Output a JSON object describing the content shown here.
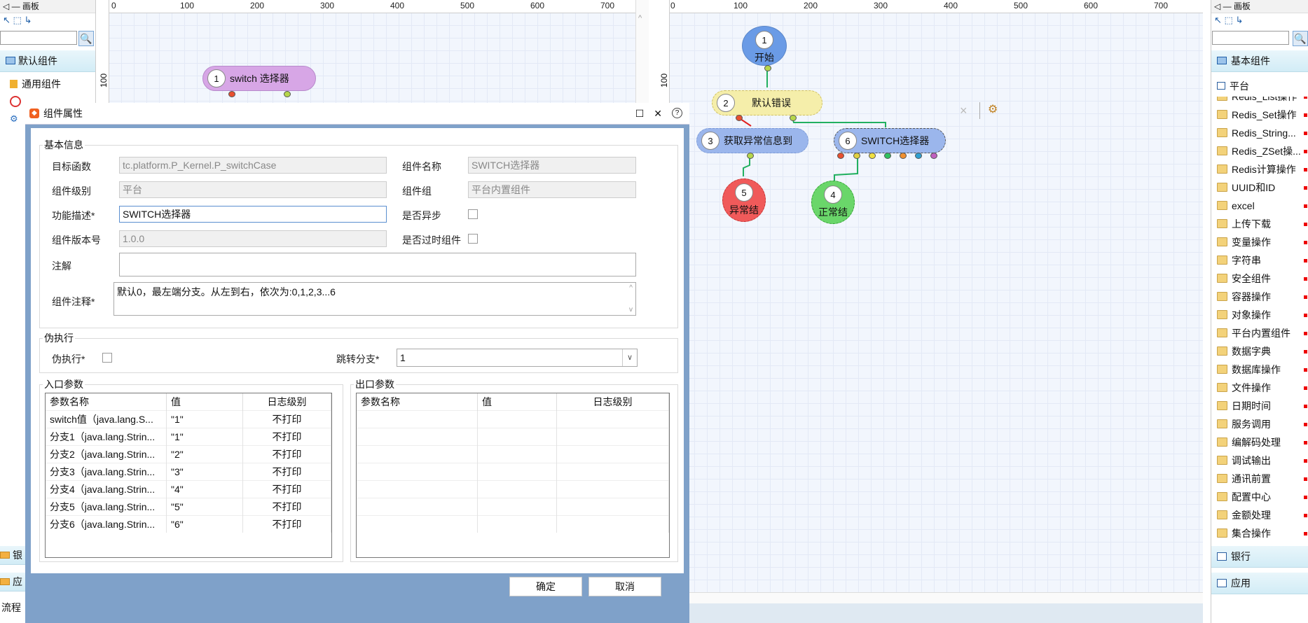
{
  "left_palette": {
    "title": "画板",
    "category_default": "默认组件",
    "item_common": "通用组件",
    "bottom_items": [
      "银",
      "应",
      "流程"
    ]
  },
  "left_canvas": {
    "ruler_h": [
      "0",
      "100",
      "200",
      "300",
      "400",
      "500",
      "600",
      "700"
    ],
    "ruler_v": [
      "100"
    ],
    "node": {
      "num": "1",
      "label": "switch 选择器"
    }
  },
  "right_canvas": {
    "ruler_h": [
      "0",
      "100",
      "200",
      "300",
      "400",
      "500",
      "600",
      "700"
    ],
    "ruler_v": [
      "100"
    ],
    "nodes": {
      "n1": {
        "num": "1",
        "label": "开始"
      },
      "n2": {
        "num": "2",
        "label": "默认错误"
      },
      "n3": {
        "num": "3",
        "label": "获取异常信息到"
      },
      "n4": {
        "num": "4",
        "label": "正常结"
      },
      "n5": {
        "num": "5",
        "label": "异常结"
      },
      "n6": {
        "num": "6",
        "label": "SWITCH选择器"
      }
    }
  },
  "right_palette": {
    "title": "画板",
    "cat_basic": "基本组件",
    "cat_platform": "平台",
    "items": [
      "Redis_List操作",
      "Redis_Set操作",
      "Redis_String...",
      "Redis_ZSet操...",
      "Redis计算操作",
      "UUID和ID",
      "excel",
      "上传下载",
      "变量操作",
      "字符串",
      "安全组件",
      "容器操作",
      "对象操作",
      "平台内置组件",
      "数据字典",
      "数据库操作",
      "文件操作",
      "日期时间",
      "服务调用",
      "编解码处理",
      "调试输出",
      "通讯前置",
      "配置中心",
      "金额处理",
      "集合操作"
    ],
    "cat_bank": "银行",
    "cat_app": "应用"
  },
  "dialog": {
    "title": "组件属性",
    "basic_group": "基本信息",
    "target_func_label": "目标函数",
    "target_func_value": "tc.platform.P_Kernel.P_switchCase",
    "comp_name_label": "组件名称",
    "comp_name_value": "SWITCH选择器",
    "comp_level_label": "组件级别",
    "comp_level_value": "平台",
    "comp_group_label": "组件组",
    "comp_group_value": "平台内置组件",
    "func_desc_label": "功能描述*",
    "func_desc_value": "SWITCH选择器",
    "async_label": "是否异步",
    "version_label": "组件版本号",
    "version_value": "1.0.0",
    "deprecated_label": "是否过时组件",
    "note_label": "注解",
    "note_value": "",
    "comment_label": "组件注释*",
    "comment_value": "默认0，最左端分支。从左到右，依次为:0,1,2,3...6",
    "mock_group": "伪执行",
    "mock_label": "伪执行*",
    "branch_label": "跳转分支*",
    "branch_value": "1",
    "in_group": "入口参数",
    "out_group": "出口参数",
    "in_headers": [
      "参数名称",
      "值",
      "日志级别"
    ],
    "in_rows": [
      [
        "switch值（java.lang.S...",
        "\"1\"",
        "不打印"
      ],
      [
        "分支1（java.lang.Strin...",
        "\"1\"",
        "不打印"
      ],
      [
        "分支2（java.lang.Strin...",
        "\"2\"",
        "不打印"
      ],
      [
        "分支3（java.lang.Strin...",
        "\"3\"",
        "不打印"
      ],
      [
        "分支4（java.lang.Strin...",
        "\"4\"",
        "不打印"
      ],
      [
        "分支5（java.lang.Strin...",
        "\"5\"",
        "不打印"
      ],
      [
        "分支6（java.lang.Strin...",
        "\"6\"",
        "不打印"
      ]
    ],
    "out_headers": [
      "参数名称",
      "值",
      "日志级别"
    ],
    "ok": "确定",
    "cancel": "取消"
  }
}
